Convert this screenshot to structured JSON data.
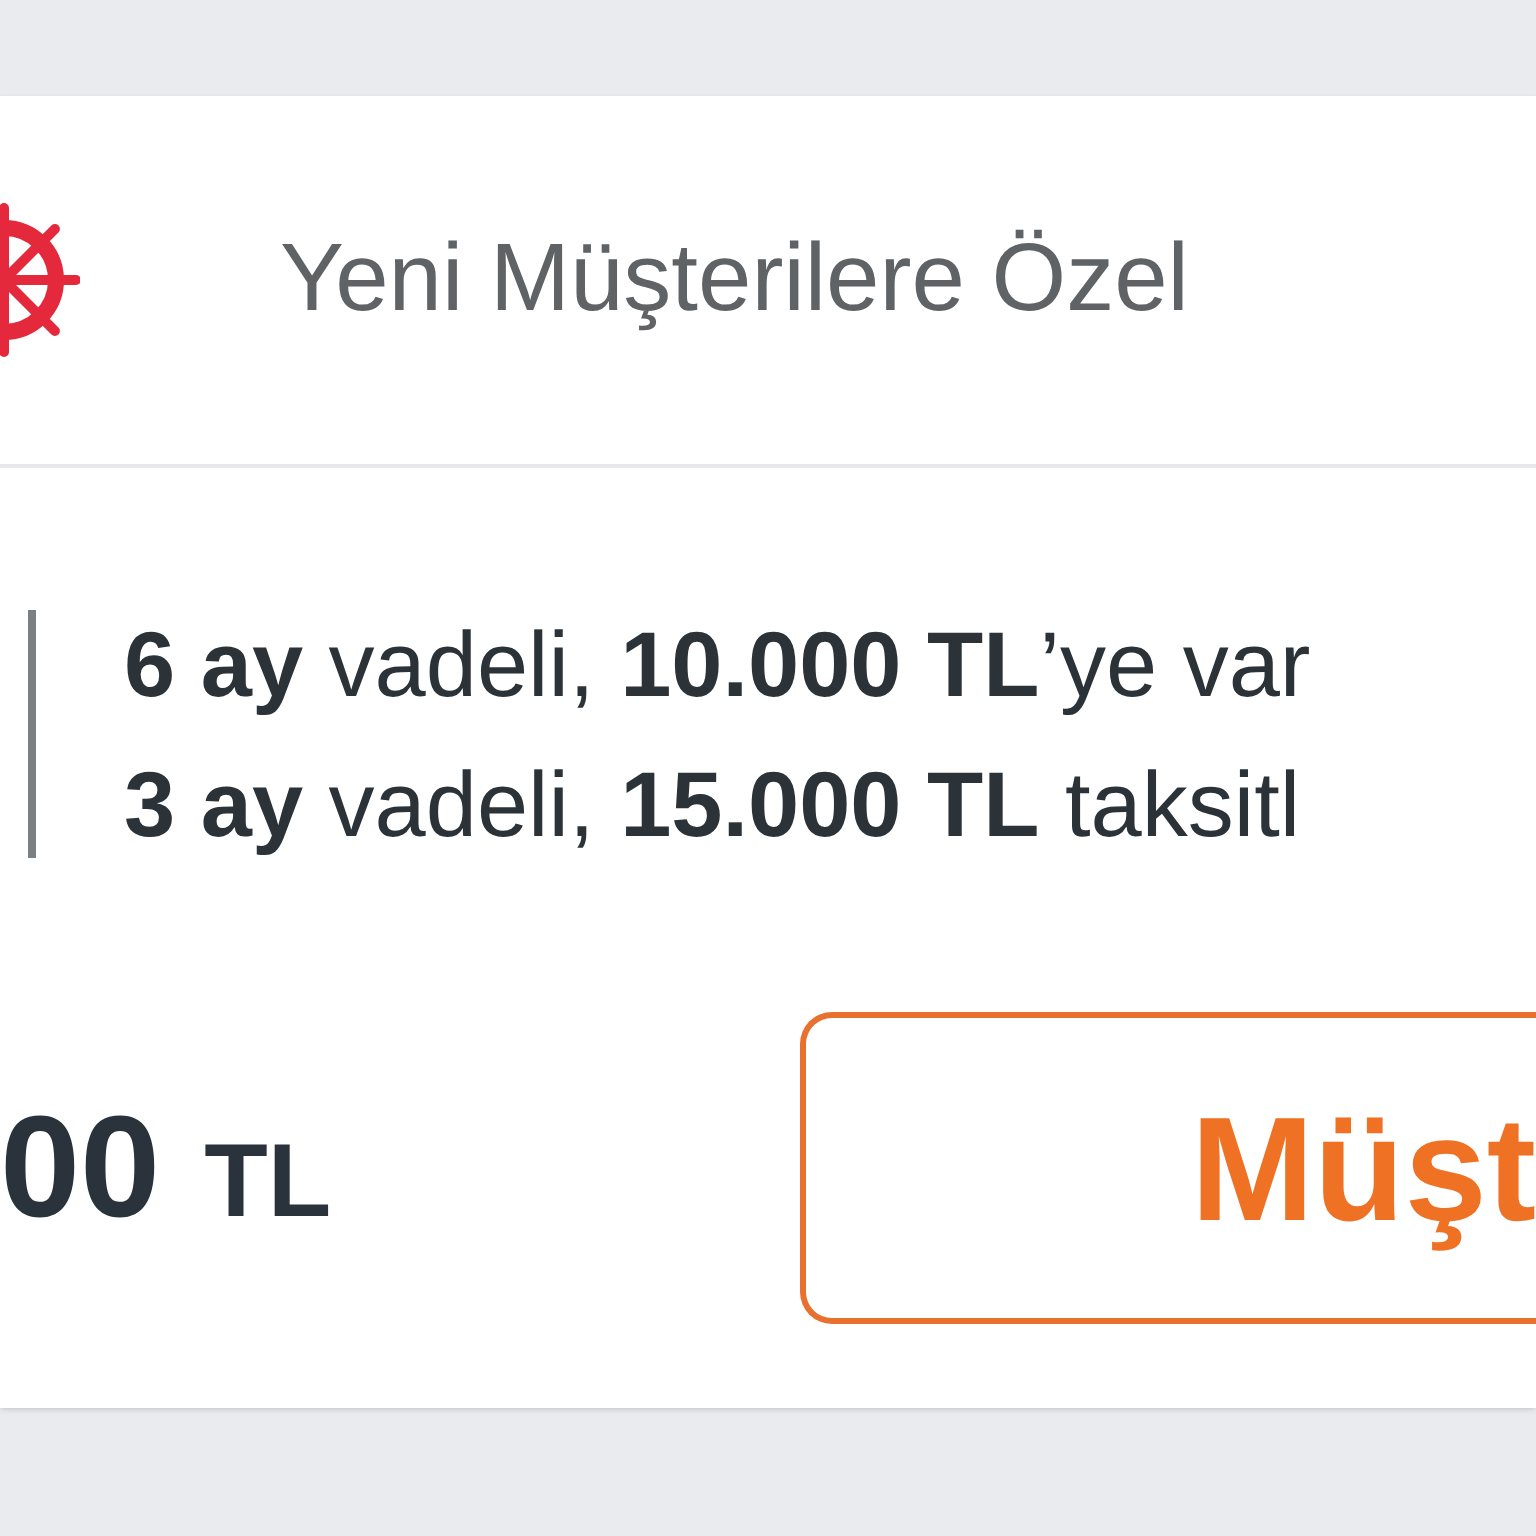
{
  "card": {
    "title": "Yeni Müşterilere Özel",
    "terms": [
      "**6 ay** vadeli, **10.000 TL**’ye var",
      "**3 ay** vadeli, **15.000 TL** taksitl"
    ],
    "amount": {
      "value": "00",
      "currency": "TL"
    },
    "button": "Müşt"
  }
}
